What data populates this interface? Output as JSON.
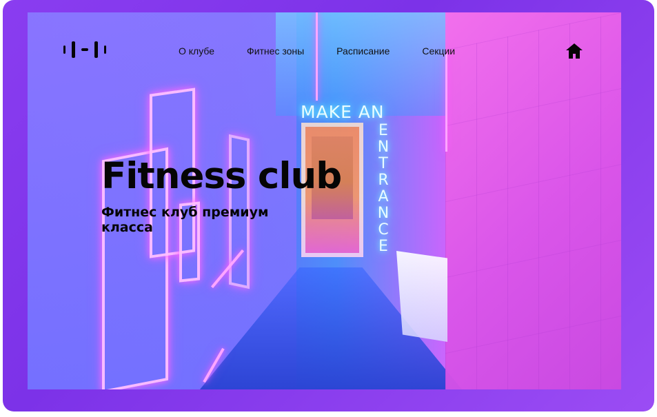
{
  "header": {
    "logo_icon": "dumbbell-icon",
    "nav": [
      {
        "label": "О клубе"
      },
      {
        "label": "Фитнес зоны"
      },
      {
        "label": "Расписание"
      },
      {
        "label": "Секции"
      }
    ],
    "home_icon": "home-icon"
  },
  "hero": {
    "title": "Fitness club",
    "subtitle": "Фитнес клуб премиум класса",
    "scene": {
      "sign_text": "MAKE AN",
      "vertical_sign_text": "ENTRANCE"
    }
  },
  "colors": {
    "frame_purple": "#8a3df0",
    "text_black": "#050505",
    "neon_pink": "#ff66ff",
    "neon_blue": "#6effff"
  }
}
